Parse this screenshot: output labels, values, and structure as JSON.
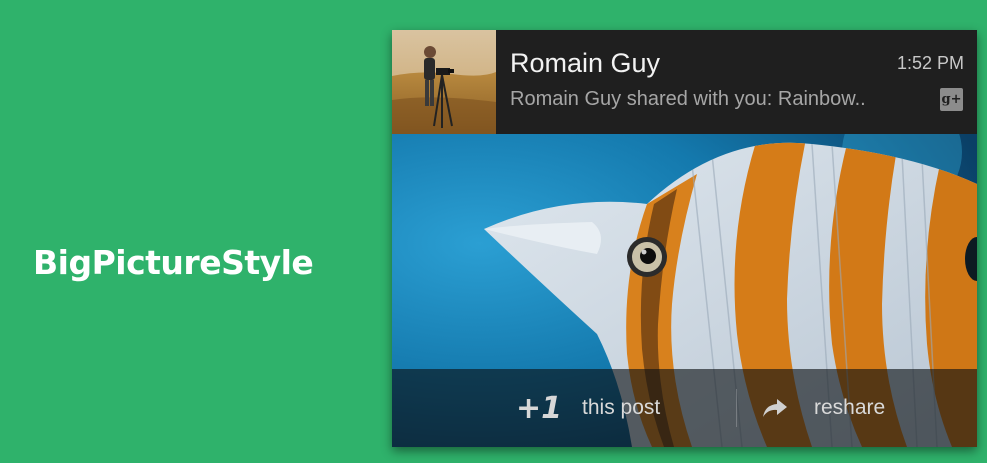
{
  "slide": {
    "title": "BigPictureStyle",
    "background_color": "#2fb26b"
  },
  "notification": {
    "avatar_icon": "profile-photo",
    "sender": "Romain Guy",
    "time": "1:52 PM",
    "summary": "Romain Guy shared with you: Rainbow..",
    "app_icon": "google-plus-icon",
    "app_icon_text": "g+",
    "big_picture": "butterflyfish-photo",
    "actions": [
      {
        "icon": "plus-one-icon",
        "icon_text": "+1",
        "label": "this post"
      },
      {
        "icon": "reshare-arrow-icon",
        "label": "reshare"
      }
    ]
  }
}
